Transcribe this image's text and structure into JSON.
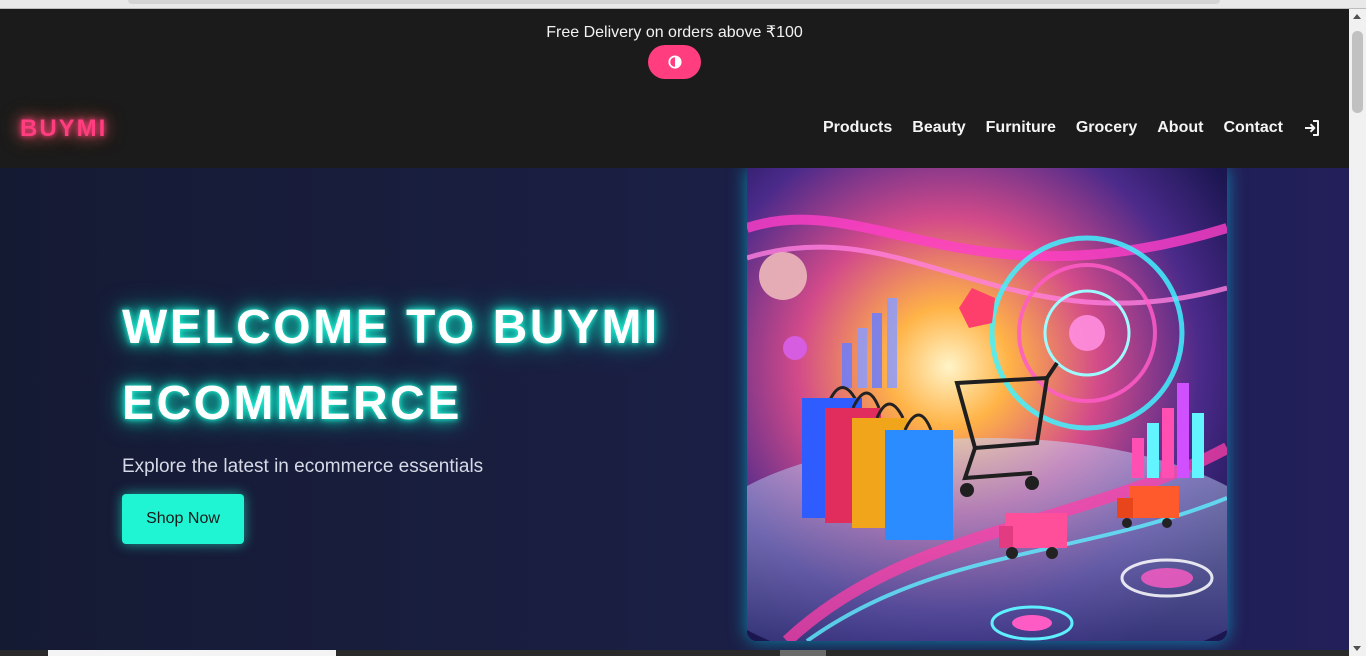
{
  "announcement": {
    "text": "Free Delivery on orders above ₹100",
    "theme_toggle_icon": "half-circle-contrast-icon"
  },
  "header": {
    "logo": "BUYMI",
    "nav": [
      {
        "label": "Products"
      },
      {
        "label": "Beauty"
      },
      {
        "label": "Furniture"
      },
      {
        "label": "Grocery"
      },
      {
        "label": "About"
      },
      {
        "label": "Contact"
      }
    ],
    "login_icon": "sign-in-icon"
  },
  "hero": {
    "title_line1": "WELCOME TO BUYMI",
    "title_line2": "ECOMMERCE",
    "subtitle": "Explore the latest in ecommerce essentials",
    "cta_label": "Shop Now",
    "image_icon": "shopping-cart-illustration-icon"
  },
  "colors": {
    "brand_pink": "#ff3d7f",
    "accent_teal": "#1ff5d2",
    "header_bg": "#1b1b1b",
    "hero_bg": "#1a1f42"
  }
}
